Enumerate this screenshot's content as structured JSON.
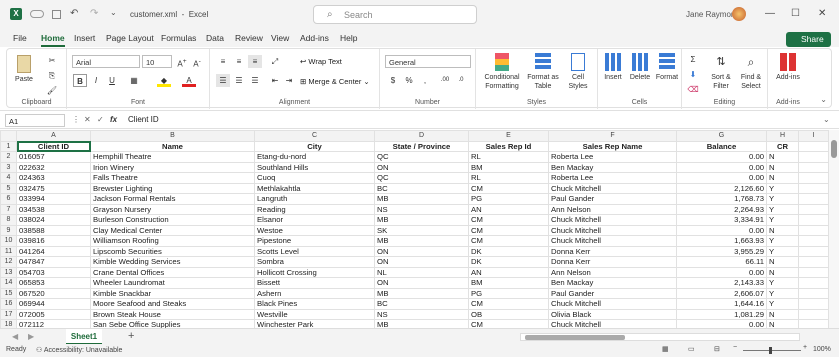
{
  "titlebar": {
    "filename": "customer.xml",
    "app": "Excel",
    "search_placeholder": "Search",
    "user": "Jane Raymond"
  },
  "menu": {
    "tabs": [
      "File",
      "Home",
      "Insert",
      "Page Layout",
      "Formulas",
      "Data",
      "Review",
      "View",
      "Add-ins",
      "Help"
    ],
    "active": "Home",
    "share_label": "Share"
  },
  "ribbon": {
    "clipboard": {
      "label": "Clipboard",
      "paste": "Paste"
    },
    "font": {
      "label": "Font",
      "family": "Arial",
      "size": "10"
    },
    "alignment": {
      "label": "Alignment",
      "wrap": "Wrap Text",
      "merge": "Merge & Center"
    },
    "number": {
      "label": "Number",
      "format": "General"
    },
    "styles": {
      "label": "Styles",
      "cond": "Conditional Formatting",
      "table": "Format as Table",
      "cell": "Cell Styles"
    },
    "cells": {
      "label": "Cells",
      "insert": "Insert",
      "delete": "Delete",
      "format": "Format"
    },
    "editing": {
      "label": "Editing",
      "sort": "Sort & Filter",
      "find": "Find & Select"
    },
    "addins": {
      "label": "Add-ins",
      "btn": "Add-ins"
    }
  },
  "formula_bar": {
    "cell": "A1",
    "value": "Client ID"
  },
  "sheet": {
    "columns": [
      "A",
      "B",
      "C",
      "D",
      "E",
      "F",
      "G",
      "H",
      "I"
    ],
    "header": [
      "Client ID",
      "Name",
      "City",
      "State / Province",
      "Sales Rep Id",
      "Sales Rep Name",
      "Balance",
      "CR"
    ],
    "rows": [
      [
        "016057",
        "Hemphill Theatre",
        "Etang-du-nord",
        "QC",
        "RL",
        "Roberta Lee",
        "0.00",
        "N"
      ],
      [
        "022632",
        "Irion Winery",
        "Southland Hills",
        "ON",
        "BM",
        "Ben Mackay",
        "0.00",
        "N"
      ],
      [
        "024363",
        "Falls Theatre",
        "Cuoq",
        "QC",
        "RL",
        "Roberta Lee",
        "0.00",
        "N"
      ],
      [
        "032475",
        "Brewster Lighting",
        "Methlakahtla",
        "BC",
        "CM",
        "Chuck Mitchell",
        "2,126.60",
        "Y"
      ],
      [
        "033994",
        "Jackson Formal Rentals",
        "Langruth",
        "MB",
        "PG",
        "Paul Gander",
        "1,768.73",
        "Y"
      ],
      [
        "034538",
        "Grayson Nursery",
        "Reading",
        "NS",
        "AN",
        "Ann Nelson",
        "2,264.93",
        "Y"
      ],
      [
        "038024",
        "Burleson Construction",
        "Elsanor",
        "MB",
        "CM",
        "Chuck Mitchell",
        "3,334.91",
        "Y"
      ],
      [
        "038588",
        "Clay Medical Center",
        "Westoe",
        "SK",
        "CM",
        "Chuck Mitchell",
        "0.00",
        "N"
      ],
      [
        "039816",
        "Williamson Roofing",
        "Pipestone",
        "MB",
        "CM",
        "Chuck Mitchell",
        "1,663.93",
        "Y"
      ],
      [
        "041264",
        "Lipscomb Securities",
        "Scotts Level",
        "ON",
        "DK",
        "Donna Kerr",
        "3,955.29",
        "Y"
      ],
      [
        "047847",
        "Kimble Wedding Services",
        "Sombra",
        "ON",
        "DK",
        "Donna Kerr",
        "66.11",
        "N"
      ],
      [
        "054703",
        "Crane Dental Offices",
        "Hollicott Crossing",
        "NL",
        "AN",
        "Ann Nelson",
        "0.00",
        "N"
      ],
      [
        "065853",
        "Wheeler Laundromat",
        "Bissett",
        "ON",
        "BM",
        "Ben Mackay",
        "2,143.33",
        "Y"
      ],
      [
        "067520",
        "Kimble Snackbar",
        "Ashern",
        "MB",
        "PG",
        "Paul Gander",
        "2,606.07",
        "Y"
      ],
      [
        "069944",
        "Moore Seafood and Steaks",
        "Black Pines",
        "BC",
        "CM",
        "Chuck Mitchell",
        "1,644.16",
        "Y"
      ],
      [
        "072005",
        "Brown Steak House",
        "Westville",
        "NS",
        "OB",
        "Olivia Black",
        "1,081.29",
        "N"
      ],
      [
        "072112",
        "San Sebe Office Supplies",
        "Winchester Park",
        "MB",
        "CM",
        "Chuck Mitchell",
        "0.00",
        "N"
      ]
    ]
  },
  "sheet_tab": "Sheet1",
  "status": {
    "ready": "Ready",
    "accessibility": "Accessibility: Unavailable",
    "zoom": "100%"
  }
}
